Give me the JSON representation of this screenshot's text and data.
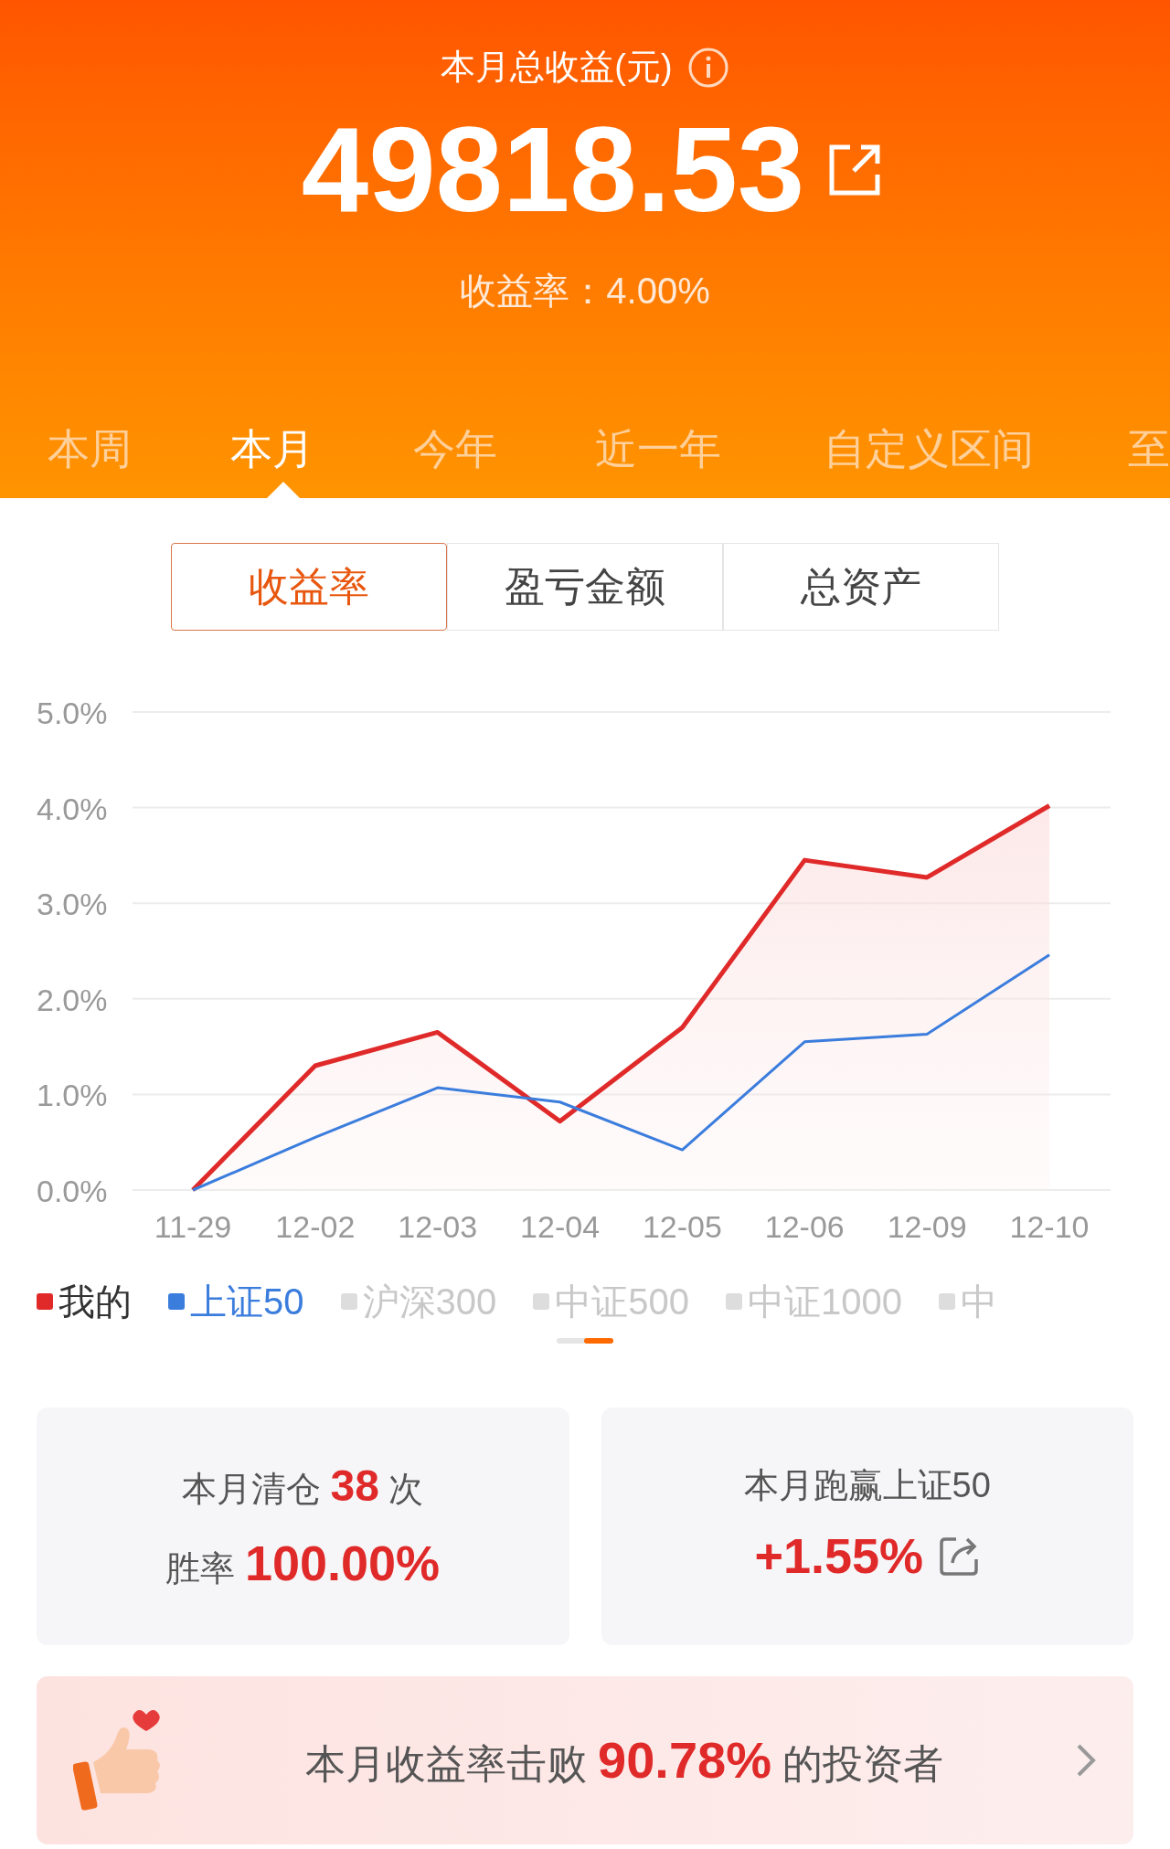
{
  "header": {
    "title": "本月总收益(元)",
    "amount": "49818.53",
    "rate": "收益率：4.00%"
  },
  "period_tabs": [
    {
      "label": "本周",
      "selected": false
    },
    {
      "label": "本月",
      "selected": true
    },
    {
      "label": "今年",
      "selected": false
    },
    {
      "label": "近一年",
      "selected": false
    },
    {
      "label": "自定义区间",
      "selected": false
    },
    {
      "label": "至",
      "selected": false
    }
  ],
  "metric_tabs": [
    {
      "label": "收益率",
      "selected": true
    },
    {
      "label": "盈亏金额",
      "selected": false
    },
    {
      "label": "总资产",
      "selected": false
    }
  ],
  "chart": {
    "series_toggles": [
      {
        "selected": true
      },
      {
        "selected": true
      }
    ],
    "chart_data": {
      "type": "line",
      "grid": true,
      "categories": [
        "11-29",
        "12-02",
        "12-03",
        "12-04",
        "12-05",
        "12-06",
        "12-09",
        "12-10"
      ],
      "ylim": [
        0,
        5
      ],
      "yticks": [
        {
          "value": 0,
          "label": "0.0%"
        },
        {
          "value": 1,
          "label": "1.0%"
        },
        {
          "value": 2,
          "label": "2.0%"
        },
        {
          "value": 3,
          "label": "3.0%"
        },
        {
          "value": 4,
          "label": "4.0%"
        },
        {
          "value": 5,
          "label": "5.0%"
        }
      ],
      "series": [
        {
          "name": "我的",
          "color": "#e02a2a",
          "type": "area",
          "values": [
            0,
            1.3,
            1.65,
            0.72,
            1.7,
            3.45,
            3.27,
            4.02
          ]
        },
        {
          "name": "上证50",
          "color": "#3b7ddd",
          "type": "line",
          "values": [
            0,
            0.55,
            1.07,
            0.92,
            0.42,
            1.55,
            1.63,
            2.46
          ]
        }
      ]
    }
  },
  "legend": [
    {
      "label": "沪深300",
      "color": "#dddddd",
      "selected": false
    },
    {
      "label": "中证500",
      "color": "#dddddd",
      "selected": false
    },
    {
      "label": "中证1000",
      "color": "#dddddd",
      "selected": false
    },
    {
      "label": "中",
      "color": "#dddddd",
      "selected": false
    }
  ],
  "cards": [
    {
      "lines": [
        "本月清仓 **38** 次",
        "胜率 **100.00%**"
      ]
    },
    {
      "lines": [
        "本月跑赢上证50",
        "**+1.55%**"
      ],
      "share": true
    }
  ],
  "banner": {
    "text": "本月收益率击败 **90.78%** 的投资者"
  }
}
